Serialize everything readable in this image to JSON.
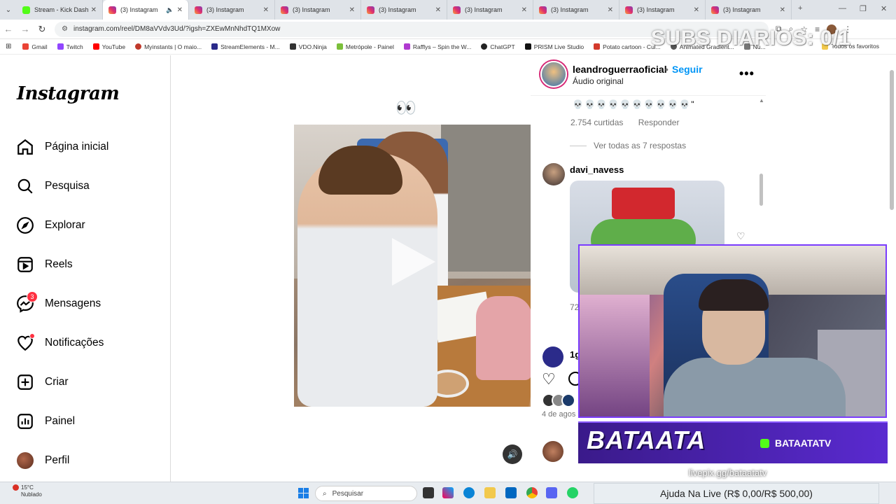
{
  "browser": {
    "tabs": [
      {
        "label": "Stream - Kick Dashbo",
        "favicon": "kick-icon"
      },
      {
        "label": "(3) Instagram",
        "favicon": "instagram-icon",
        "active": true
      },
      {
        "label": "(3) Instagram",
        "favicon": "instagram-icon"
      },
      {
        "label": "(3) Instagram",
        "favicon": "instagram-icon"
      },
      {
        "label": "(3) Instagram",
        "favicon": "instagram-icon"
      },
      {
        "label": "(3) Instagram",
        "favicon": "instagram-icon"
      },
      {
        "label": "(3) Instagram",
        "favicon": "instagram-icon"
      },
      {
        "label": "(3) Instagram",
        "favicon": "instagram-icon"
      },
      {
        "label": "(3) Instagram",
        "favicon": "instagram-icon"
      }
    ],
    "url": "instagram.com/reel/DM8aVVdv3Ud/?igsh=ZXEwMnNhdTQ1MXow",
    "bookmarks": [
      {
        "label": "Gmail",
        "color": "#ea4335"
      },
      {
        "label": "Twitch",
        "color": "#9146ff"
      },
      {
        "label": "YouTube",
        "color": "#ff0000"
      },
      {
        "label": "Myinstants | O maio...",
        "color": "#c0392b"
      },
      {
        "label": "StreamElements - M...",
        "color": "#2a2a8a"
      },
      {
        "label": "VDO.Ninja",
        "color": "#333333"
      },
      {
        "label": "Metrópole - Painel",
        "color": "#7bbf3a"
      },
      {
        "label": "Rafflys – Spin the W...",
        "color": "#b03ad0"
      },
      {
        "label": "ChatGPT",
        "color": "#222222"
      },
      {
        "label": "PRISM Live Studio",
        "color": "#111111"
      },
      {
        "label": "Potato cartoon - Cul...",
        "color": "#d33a2c"
      },
      {
        "label": "Animated Gradient...",
        "color": "#555555"
      },
      {
        "label": "Nu...",
        "color": "#777777"
      }
    ],
    "all_bookmarks": "Todos os favoritos"
  },
  "sidebar": {
    "logo": "Instagram",
    "items": [
      {
        "label": "Página inicial",
        "icon": "home-icon"
      },
      {
        "label": "Pesquisa",
        "icon": "search-icon"
      },
      {
        "label": "Explorar",
        "icon": "compass-icon"
      },
      {
        "label": "Reels",
        "icon": "reels-icon"
      },
      {
        "label": "Mensagens",
        "icon": "messenger-icon",
        "badge": "3"
      },
      {
        "label": "Notificações",
        "icon": "heart-icon",
        "dot": true
      },
      {
        "label": "Criar",
        "icon": "plus-square-icon"
      },
      {
        "label": "Painel",
        "icon": "chart-icon"
      },
      {
        "label": "Perfil",
        "icon": "avatar"
      }
    ]
  },
  "post": {
    "eyes_emoji": "👀",
    "author": "leandroguerraoficial",
    "separator": "•",
    "follow_label": "Seguir",
    "audio": "Áudio original",
    "comment_text": "💀💀💀💀💀💀💀💀💀💀\"",
    "likes": "2.754 curtidas",
    "reply_label": "Responder",
    "view_replies": "Ver todas as 7 respostas",
    "commenter": "davi_navess",
    "count_fragment": "72",
    "reply_fragment": "1g",
    "date_fragment": "4 de agos"
  },
  "overlay": {
    "subs": "SUBS DIARIOS: 0/1",
    "streamer_name": "BATAATA",
    "handle": "BATAATATV",
    "livepix": "livepix.gg/bataatatv",
    "donation": "Ajuda Na Live (R$ 0,00/R$ 500,00)"
  },
  "taskbar": {
    "temperature": "15°C",
    "weather": "Nublado",
    "search_placeholder": "Pesquisar"
  },
  "colors": {
    "instagram_blue": "#0095f6",
    "notification_red": "#ff3040",
    "overlay_purple": "#5a2ad0"
  }
}
